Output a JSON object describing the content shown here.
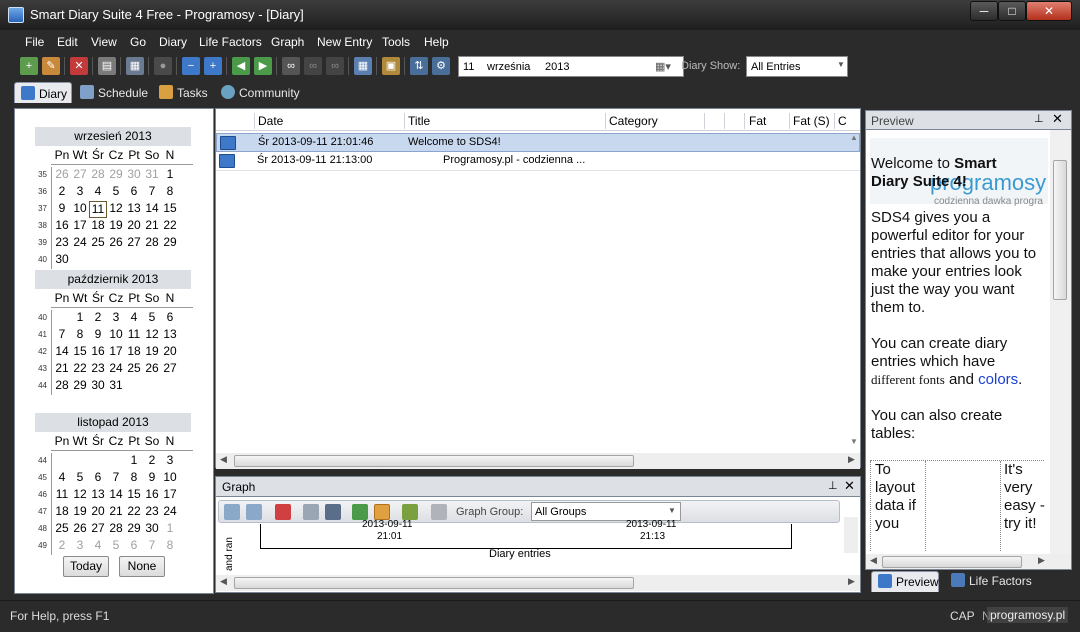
{
  "window": {
    "title": "Smart Diary Suite 4 Free - Programosy - [Diary]",
    "controls": {
      "minimize": "─",
      "maximize": "□",
      "close": "✕"
    }
  },
  "menu": [
    "File",
    "Edit",
    "View",
    "Go",
    "Diary",
    "Life Factors",
    "Graph",
    "New Entry",
    "Tools",
    "Help"
  ],
  "toolbar": {
    "date": {
      "day": "11",
      "month": "września",
      "year": "2013"
    },
    "diary_show_label": "Diary Show:",
    "diary_show_value": "All Entries"
  },
  "tabs": [
    "Diary",
    "Schedule",
    "Tasks",
    "Community"
  ],
  "calendar": {
    "weekday_headers": [
      "Pn",
      "Wt",
      "Śr",
      "Cz",
      "Pt",
      "So",
      "N"
    ],
    "months": [
      {
        "title": "wrzesień 2013",
        "weeks": [
          {
            "num": "35",
            "days": [
              "26",
              "27",
              "28",
              "29",
              "30",
              "31",
              "1"
            ]
          },
          {
            "num": "36",
            "days": [
              "2",
              "3",
              "4",
              "5",
              "6",
              "7",
              "8"
            ]
          },
          {
            "num": "37",
            "days": [
              "9",
              "10",
              "11",
              "12",
              "13",
              "14",
              "15"
            ]
          },
          {
            "num": "38",
            "days": [
              "16",
              "17",
              "18",
              "19",
              "20",
              "21",
              "22"
            ]
          },
          {
            "num": "39",
            "days": [
              "23",
              "24",
              "25",
              "26",
              "27",
              "28",
              "29"
            ]
          },
          {
            "num": "40",
            "days": [
              "30",
              "",
              "",
              "",
              "",
              "",
              ""
            ]
          }
        ]
      },
      {
        "title": "październik 2013",
        "weeks": [
          {
            "num": "40",
            "days": [
              "",
              "1",
              "2",
              "3",
              "4",
              "5",
              "6"
            ]
          },
          {
            "num": "41",
            "days": [
              "7",
              "8",
              "9",
              "10",
              "11",
              "12",
              "13"
            ]
          },
          {
            "num": "42",
            "days": [
              "14",
              "15",
              "16",
              "17",
              "18",
              "19",
              "20"
            ]
          },
          {
            "num": "43",
            "days": [
              "21",
              "22",
              "23",
              "24",
              "25",
              "26",
              "27"
            ]
          },
          {
            "num": "44",
            "days": [
              "28",
              "29",
              "30",
              "31",
              "",
              "",
              ""
            ]
          }
        ]
      },
      {
        "title": "listopad 2013",
        "weeks": [
          {
            "num": "44",
            "days": [
              "",
              "",
              "",
              "",
              "1",
              "2",
              "3"
            ]
          },
          {
            "num": "45",
            "days": [
              "4",
              "5",
              "6",
              "7",
              "8",
              "9",
              "10"
            ]
          },
          {
            "num": "46",
            "days": [
              "11",
              "12",
              "13",
              "14",
              "15",
              "16",
              "17"
            ]
          },
          {
            "num": "47",
            "days": [
              "18",
              "19",
              "20",
              "21",
              "22",
              "23",
              "24"
            ]
          },
          {
            "num": "48",
            "days": [
              "25",
              "26",
              "27",
              "28",
              "29",
              "30",
              "1"
            ]
          },
          {
            "num": "49",
            "days": [
              "2",
              "3",
              "4",
              "5",
              "6",
              "7",
              "8"
            ]
          }
        ]
      }
    ],
    "today_button": "Today",
    "none_button": "None"
  },
  "entries": {
    "columns": [
      "Date",
      "Title",
      "Category",
      "Fat",
      "Fat (S)",
      "C"
    ],
    "rows": [
      {
        "date": "Śr 2013-09-11 21:01:46",
        "title": "Welcome to SDS4!"
      },
      {
        "date": "Śr 2013-09-11 21:13:00",
        "title": "Programosy.pl - codzienna ..."
      }
    ]
  },
  "graph": {
    "title": "Graph",
    "group_label": "Graph Group:",
    "group_value": "All Groups",
    "y_label": "and range",
    "x_ticks": [
      {
        "date": "2013-09-11",
        "time": "21:01"
      },
      {
        "date": "2013-09-11",
        "time": "21:13"
      }
    ],
    "x_axis_label": "Diary entries"
  },
  "preview": {
    "title": "Preview",
    "logo_text": "programosy",
    "logo_sub": "codzienna dawka progra",
    "paragraphs": {
      "welcome_1": "Welcome to ",
      "welcome_bold1": "Smart",
      "welcome_bold2": "Diary Suite 4!",
      "p1": [
        "SDS4 gives you a",
        "powerful editor for your",
        "entries that allows you to",
        "make your entries look",
        "just the way you want",
        "them to."
      ],
      "p2_1": "You can create diary",
      "p2_2": "entries which have",
      "p2_fonts": "different fonts",
      "p2_and": " and ",
      "p2_colors": "colors",
      "p2_dot": ".",
      "p3": [
        "You can also create",
        "tables:"
      ],
      "table_left": [
        "To",
        "layout",
        "data if",
        "you"
      ],
      "table_right": [
        "It's",
        "very",
        "easy -",
        "try it!"
      ]
    },
    "tabs": [
      "Preview",
      "Life Factors"
    ]
  },
  "status": {
    "help": "For Help, press F1",
    "cap": "CAP",
    "num": "N",
    "watermark": "programosy.pl"
  },
  "colors": {
    "accent": "#3e78c8",
    "selection": "#c8d8ee",
    "link_blue": "#1a3fd0"
  }
}
